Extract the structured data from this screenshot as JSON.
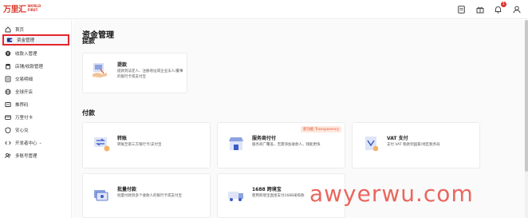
{
  "brand": {
    "logo_text": "万里汇",
    "logo_subtext": "WORLD FIRST",
    "accent_color": "#e4262c"
  },
  "topbar": {
    "icons": [
      "document-icon",
      "gift-icon",
      "bell-icon",
      "user-icon"
    ],
    "notification_count": "1"
  },
  "sidebar": {
    "items": [
      {
        "label": "首页",
        "icon": "home-icon",
        "active": false
      },
      {
        "label": "资金管理",
        "icon": "wallet-icon",
        "active": true
      },
      {
        "label": "收款入管理",
        "icon": "receive-icon",
        "active": false
      },
      {
        "label": "店铺/收款管理",
        "icon": "store-icon",
        "active": false
      },
      {
        "label": "交易明细",
        "icon": "list-icon",
        "active": false
      },
      {
        "label": "全球开店",
        "icon": "globe-icon",
        "active": false
      },
      {
        "label": "推荐码",
        "icon": "tag-icon",
        "active": false
      },
      {
        "label": "万里付卡",
        "icon": "card-icon",
        "active": false
      },
      {
        "label": "安心兑",
        "icon": "shield-icon",
        "active": false
      },
      {
        "label": "开发者中心",
        "icon": "code-icon",
        "active": false
      },
      {
        "label": "多账号管理",
        "icon": "users-icon",
        "active": false
      }
    ]
  },
  "main": {
    "page_title": "资金管理",
    "withdraw_section": {
      "title": "提款",
      "cards": [
        {
          "title": "提款",
          "desc": "提款到法定人、注册地址或企业法人/董事的银行卡或支付宝"
        }
      ]
    },
    "payment_section": {
      "title": "付款",
      "cards": [
        {
          "title": "转账",
          "desc": "转账至第三方银行卡/支付宝"
        },
        {
          "title": "服务商付付",
          "desc": "服务商广覆盖，无需添加收款人，钱能更快",
          "tag": "新功能 Transparency"
        },
        {
          "title": "VAT 支付",
          "desc": "支付 VAT 税款到国家/地区税务局"
        },
        {
          "title": "批量付款",
          "desc": "批量付款到多个收款人的银行卡或支付宝"
        },
        {
          "title": "1688 跨境宝",
          "desc": "使用跨境宝直接支付1688采购款"
        }
      ]
    }
  },
  "watermark": "awyerwu.com"
}
